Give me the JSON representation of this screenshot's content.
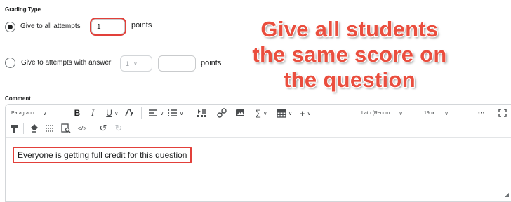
{
  "grading": {
    "section_label": "Grading Type",
    "options": [
      {
        "label": "Give to all attempts",
        "checked": true,
        "value": "1",
        "units": "points"
      },
      {
        "label": "Give to attempts with answer",
        "checked": false,
        "select_value": "1",
        "value": "",
        "units": "points"
      }
    ]
  },
  "annotation": {
    "lines": [
      "Give all students",
      "the same score on",
      "the question"
    ]
  },
  "comment": {
    "section_label": "Comment",
    "toolbar": {
      "format_select": "Paragraph",
      "font_select": "Lato (Recom…",
      "size_select": "19px …",
      "more": "···"
    },
    "body_text": "Everyone is getting full credit for this question"
  },
  "colors": {
    "annotation_red": "#ea4e3e",
    "highlight_red": "#e2403a"
  }
}
